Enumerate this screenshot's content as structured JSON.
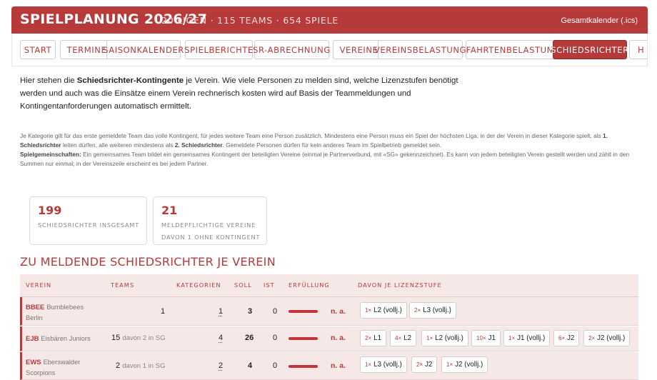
{
  "header": {
    "title": "SPIELPLANUNG 2026/27",
    "stats": "20 LIGEN · 115 TEAMS · 654 SPIELE",
    "calendar_link": "Gesamtkalender (.ics)"
  },
  "nav": {
    "tabs": [
      {
        "label": "Start"
      },
      {
        "label": "Termine"
      },
      {
        "label": "Saisonkalender"
      },
      {
        "label": "Spielberichte"
      },
      {
        "label": "SR-Abrechnung"
      },
      {
        "label": "Vereine"
      },
      {
        "label": "Vereinsbelastung"
      },
      {
        "label": "Fahrtenbelastung"
      },
      {
        "label": "Schiedsrichter"
      },
      {
        "label": "H"
      }
    ],
    "active": "Schiedsrichter"
  },
  "intro": {
    "p1": "Hier stehen die ",
    "b1": "Schiedsrichter-Kontingente",
    "p2": " je Verein. Wie viele Personen zu melden sind, welche Lizenzstufen benötigt werden und auch was die Einsätze einem Verein rechnerisch kosten wird auf Basis der Teammeldungen und Kontingentanforderungen automatisch ermittelt."
  },
  "notes": {
    "t1": "Je Kategorie gilt für das erste gemeldete Team das volle Kontingent, für jedes weitere Team eine Person zusätzlich. Mindestens eine Person muss ein Spiel der höchsten Liga, in der der Verein in dieser Kategorie spielt, als ",
    "b1": "1. Schiedsrichter",
    "t2": " leiten dürfen, alle weiteren mindestens als ",
    "b2": "2. Schiedsrichter",
    "t3": ". Gemeldete Personen dürfen für kein anderes Team im Spielbetrieb gemeldet sein.",
    "b3": "Spielgemeinschaften:",
    "t4": " Ein gemeinsames Team bildet ein gemeinsames Kontingent der beteiligten Vereine (einmal je Partnerverbund, mit «SG» gekennzeichnet). Es kann von jedem beteiligten Verein gestellt werden und zählt in den Summen nur einmal; in der Vereinszeile erscheint es bei jedem Partner."
  },
  "cards": [
    {
      "value": "199",
      "label1": "Schiedsrichter insgesamt",
      "label2": ""
    },
    {
      "value": "21",
      "label1": "Meldepflichtige Vereine",
      "label2": "davon 1 ohne Kontingent"
    }
  ],
  "section_title": "Zu meldende Schiedsrichter je Verein",
  "table": {
    "headers": {
      "verein": "Verein",
      "teams": "Teams",
      "kategorien": "Kategorien",
      "soll": "Soll",
      "ist": "Ist",
      "erfuellung": "Erfüllung",
      "lizenz": "Davon je Lizenzstufe"
    },
    "rows": [
      {
        "abbr": "BBEE",
        "name1": "Bumblebees",
        "name2": "Berlin",
        "teams": "1",
        "teams_sg": "",
        "kategorien": "1",
        "soll": "3",
        "ist": "0",
        "fulfillment": 0,
        "status": "n. a.",
        "chips": [
          {
            "mult": "1×",
            "label": "L2 (vollj.)"
          },
          {
            "mult": "2×",
            "label": "L3 (vollj.)"
          }
        ]
      },
      {
        "abbr": "EJB",
        "name1": "Eisbären Juniors",
        "name2": "",
        "teams": "15",
        "teams_sg": "davon 2 in SG",
        "kategorien": "4",
        "soll": "26",
        "ist": "0",
        "fulfillment": 0,
        "status": "n. a.",
        "chips": [
          {
            "mult": "2×",
            "label": "L1"
          },
          {
            "mult": "4×",
            "label": "L2"
          },
          {
            "mult": "1×",
            "label": "L2 (vollj.)"
          },
          {
            "mult": "10×",
            "label": "J1"
          },
          {
            "mult": "1×",
            "label": "J1 (vollj.)"
          },
          {
            "mult": "6×",
            "label": "J2"
          },
          {
            "mult": "2×",
            "label": "J2 (vollj.)"
          }
        ]
      },
      {
        "abbr": "EWS",
        "name1": "Eberswalder",
        "name2": "Scorpions",
        "teams": "2",
        "teams_sg": "davon 1 in SG",
        "kategorien": "2",
        "soll": "4",
        "ist": "0",
        "fulfillment": 0,
        "status": "n. a.",
        "chips": [
          {
            "mult": "1×",
            "label": "L3 (vollj.)"
          },
          {
            "mult": "2×",
            "label": "J2"
          },
          {
            "mult": "1×",
            "label": "J2 (vollj.)"
          }
        ]
      }
    ]
  }
}
